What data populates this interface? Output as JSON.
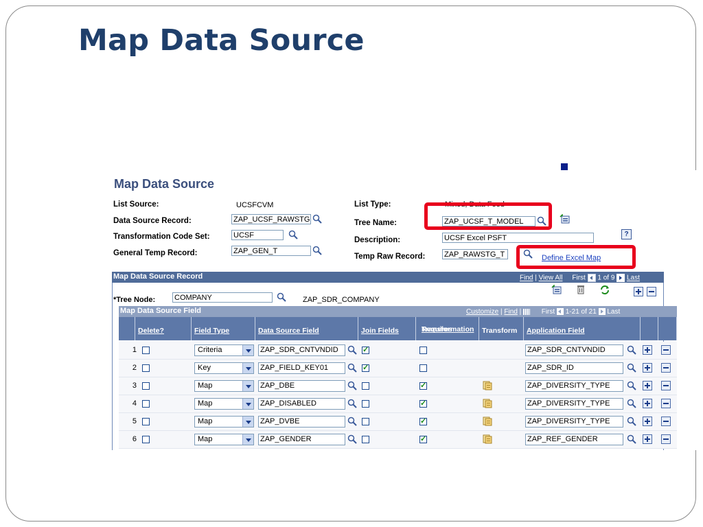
{
  "slide": {
    "title": "Map Data Source"
  },
  "panel": {
    "title": "Map Data Source",
    "list_source_label": "List Source:",
    "list_source_value": "UCSFCVM",
    "data_source_record_label": "Data Source Record:",
    "data_source_record_value": "ZAP_UCSF_RAWSTG",
    "transformation_code_set_label": "Transformation Code Set:",
    "transformation_code_set_value": "UCSF",
    "general_temp_record_label": "General Temp Record:",
    "general_temp_record_value": "ZAP_GEN_T",
    "list_type_label": "List Type:",
    "list_type_value": "Mixed, Data Feed",
    "tree_name_label": "Tree Name:",
    "tree_name_value": "ZAP_UCSF_T_MODEL",
    "description_label": "Description:",
    "description_value": "UCSF Excel PSFT",
    "temp_raw_record_label": "Temp Raw Record:",
    "temp_raw_record_value": "ZAP_RAWSTG_T",
    "define_excel_map_link": "Define Excel Map",
    "help_glyph": "?"
  },
  "record_grid": {
    "header": "Map Data Source Record",
    "find": "Find",
    "view_all": "View All",
    "sep": "|",
    "first": "First",
    "page": "1 of 9",
    "last": "Last",
    "tree_node_label": "*Tree Node:",
    "tree_node_value": "COMPANY",
    "tree_node_desc": "ZAP_SDR_COMPANY"
  },
  "field_grid": {
    "header": "Map Data Source Field",
    "customize": "Customize",
    "find": "Find",
    "sep": "|",
    "first": "First",
    "range": "1-21 of 21",
    "last": "Last",
    "columns": {
      "delete": "Delete?",
      "field_type": "Field Type",
      "data_source_field": "Data Source Field",
      "join_fields": "Join Fields",
      "requires_transformation_1": "Requires",
      "requires_transformation_2": "Transformation",
      "transform": "Transform",
      "application_field": "Application Field"
    },
    "rows": [
      {
        "num": "1",
        "delete": false,
        "field_type": "Criteria",
        "data_source_field": "ZAP_SDR_CNTVNDID",
        "join": true,
        "requires_transformation": false,
        "has_transform": false,
        "application_field": "ZAP_SDR_CNTVNDID"
      },
      {
        "num": "2",
        "delete": false,
        "field_type": "Key",
        "data_source_field": "ZAP_FIELD_KEY01",
        "join": true,
        "requires_transformation": false,
        "has_transform": false,
        "application_field": "ZAP_SDR_ID"
      },
      {
        "num": "3",
        "delete": false,
        "field_type": "Map",
        "data_source_field": "ZAP_DBE",
        "join": false,
        "requires_transformation": true,
        "has_transform": true,
        "application_field": "ZAP_DIVERSITY_TYPE"
      },
      {
        "num": "4",
        "delete": false,
        "field_type": "Map",
        "data_source_field": "ZAP_DISABLED",
        "join": false,
        "requires_transformation": true,
        "has_transform": true,
        "application_field": "ZAP_DIVERSITY_TYPE"
      },
      {
        "num": "5",
        "delete": false,
        "field_type": "Map",
        "data_source_field": "ZAP_DVBE",
        "join": false,
        "requires_transformation": true,
        "has_transform": true,
        "application_field": "ZAP_DIVERSITY_TYPE"
      },
      {
        "num": "6",
        "delete": false,
        "field_type": "Map",
        "data_source_field": "ZAP_GENDER",
        "join": false,
        "requires_transformation": true,
        "has_transform": true,
        "application_field": "ZAP_REF_GENDER"
      }
    ]
  },
  "colors": {
    "slide_title": "#1f3f6b",
    "panel_title": "#3b4f7d",
    "grid_header": "#4f6b99",
    "column_header": "#5d78a8",
    "highlight_box": "#e8001c",
    "arrow": "#0a1f8a"
  },
  "icons": [
    "lookup-magnifier-icon",
    "add-row-icon",
    "delete-row-icon",
    "refresh-icon",
    "view-all-grid-icon",
    "help-icon",
    "transform-page-icon",
    "previous-arrow-icon",
    "next-arrow-icon",
    "down-arrow-icon"
  ]
}
